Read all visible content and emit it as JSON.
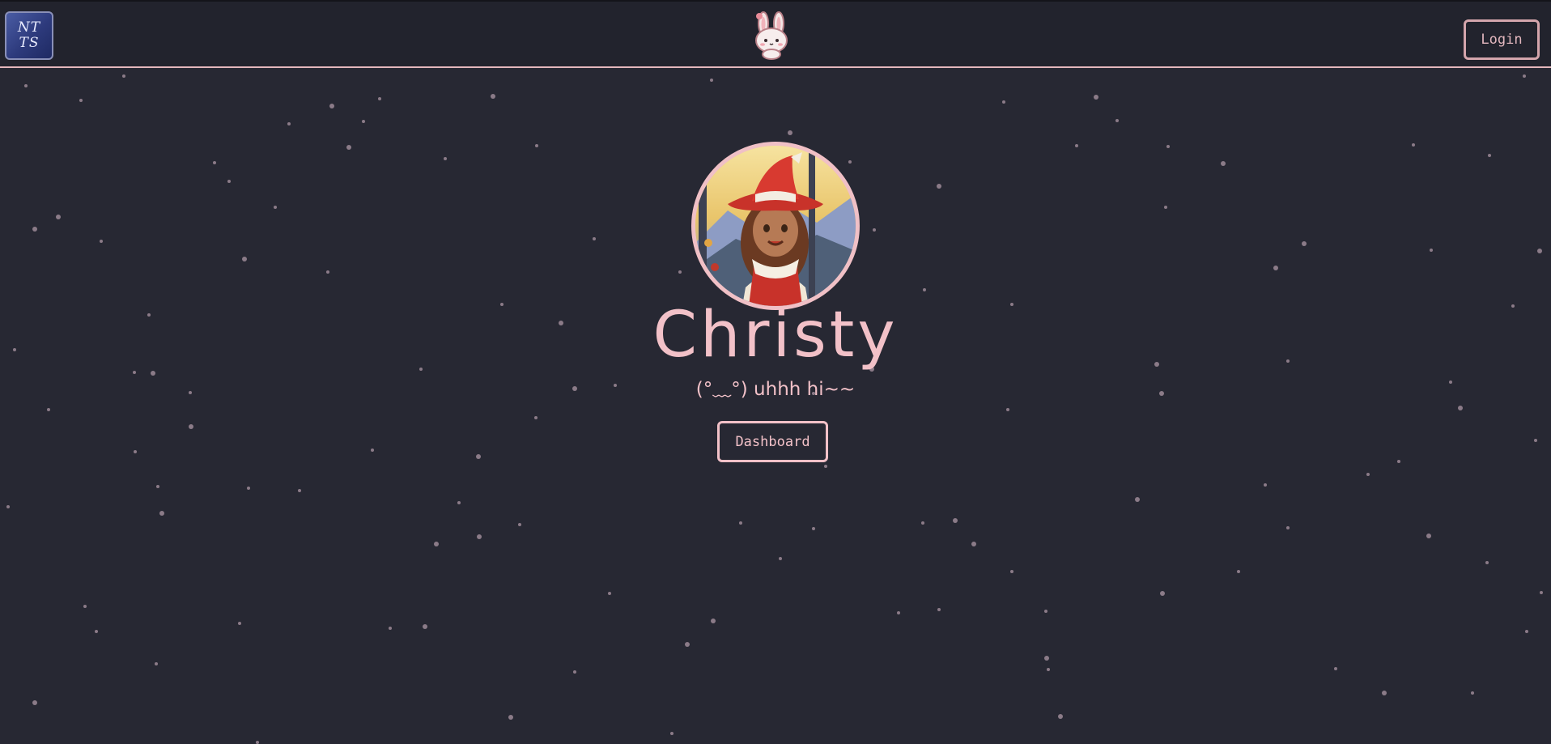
{
  "header": {
    "logo_line1": "NT",
    "logo_line2": "TS",
    "mascot_icon": "bunny-mascot-icon",
    "login_label": "Login"
  },
  "profile": {
    "name": "Christy",
    "tagline": "(°﹏°) uhhh hi~~",
    "dashboard_label": "Dashboard"
  },
  "colors": {
    "background": "#272833",
    "navbar": "#22232d",
    "accent_pink": "#f2c1c8",
    "star": "#8b7b88"
  }
}
